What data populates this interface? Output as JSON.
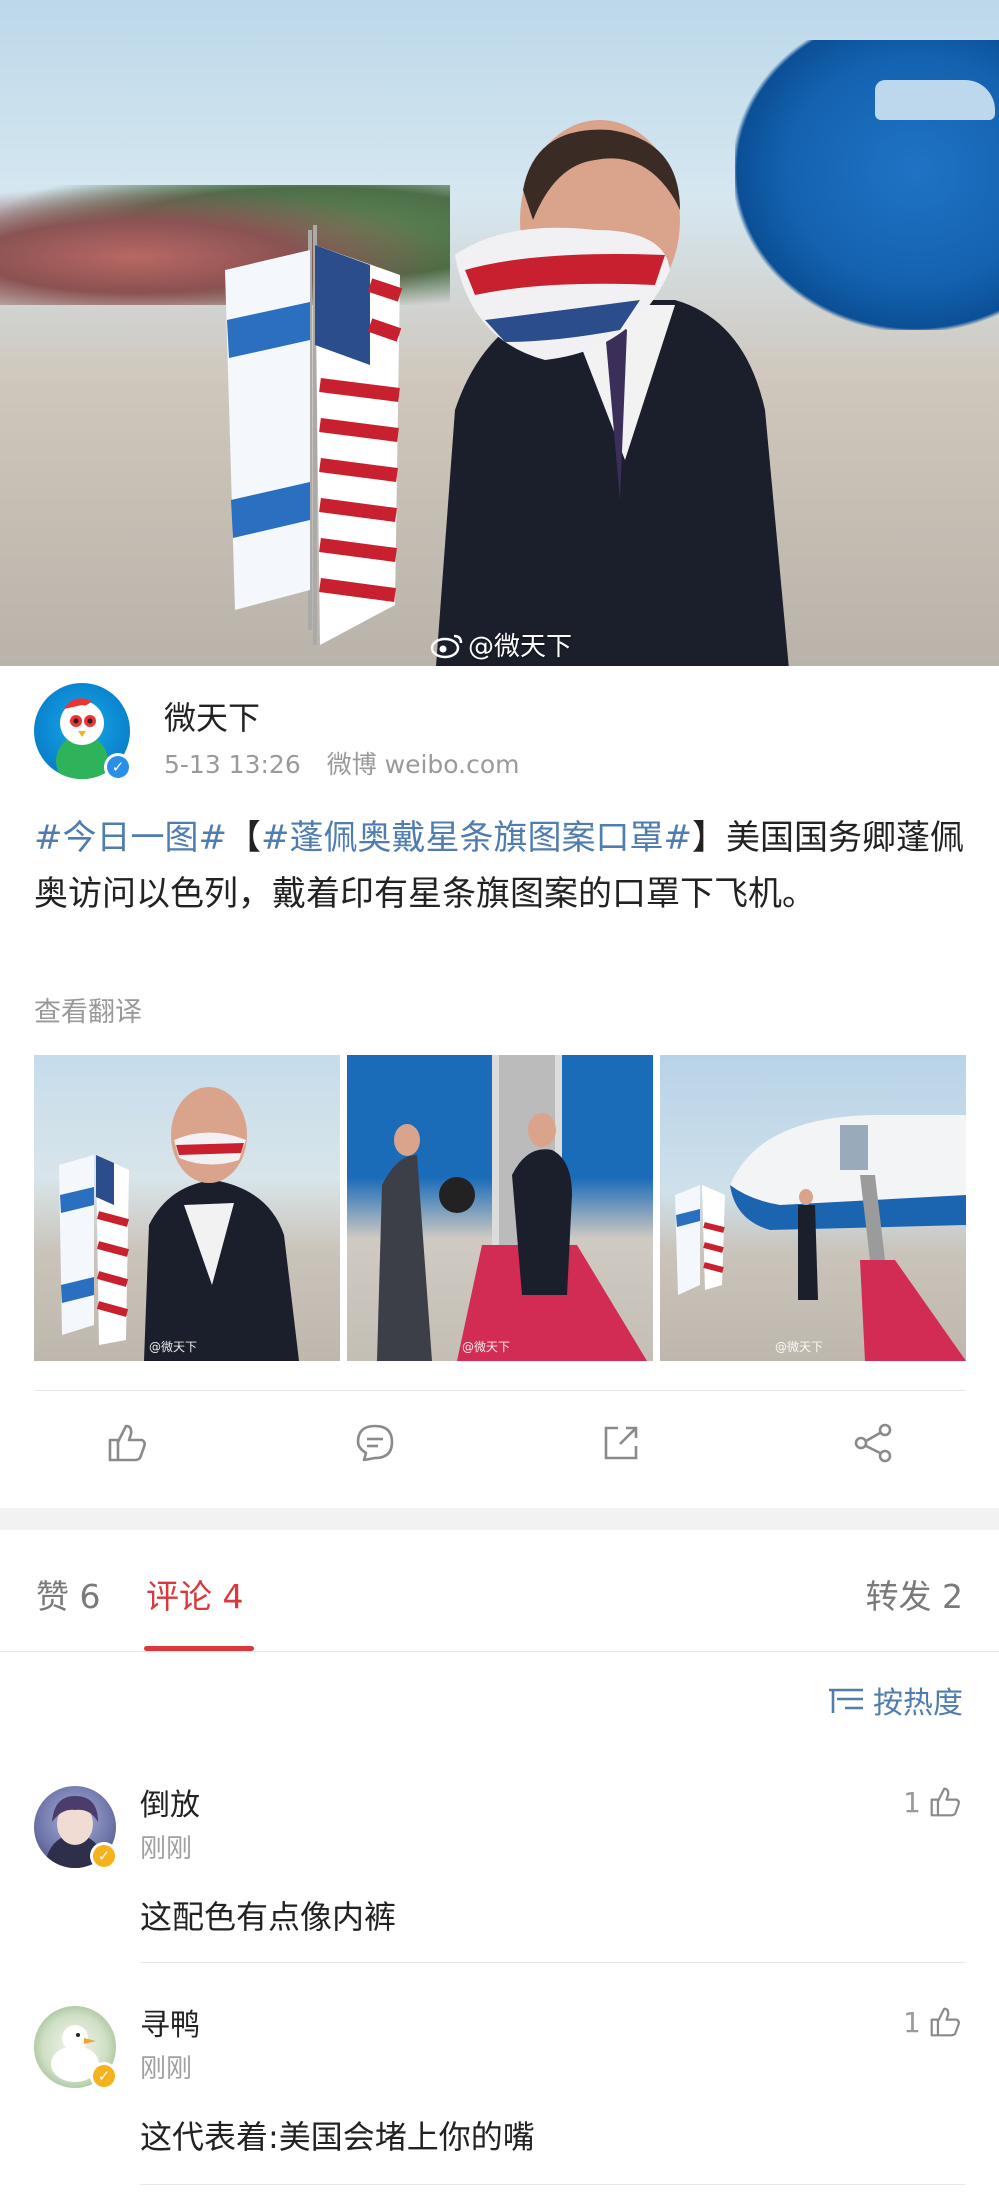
{
  "hero": {
    "watermark": "@微天下",
    "description_icon": "weibo-logo-icon"
  },
  "post": {
    "author": "微天下",
    "timestamp": "5-13 13:26",
    "source": "微博 weibo.com",
    "tag1": "#今日一图#",
    "bracket_open": "【",
    "tag2": "#蓬佩奥戴星条旗图案口罩#",
    "bracket_close": "】",
    "body": "美国国务卿蓬佩奥访问以色列，戴着印有星条旗图案的口罩下飞机。",
    "translate_link": "查看翻译",
    "thumb_watermark": "@微天下"
  },
  "actions": {
    "like_icon": "thumb-up-icon",
    "comment_icon": "comment-icon",
    "repost_icon": "repost-icon",
    "share_icon": "share-icon"
  },
  "tabs": {
    "likes": "赞 6",
    "comments": "评论 4",
    "reposts": "转发 2"
  },
  "sort": {
    "label": "按热度",
    "icon": "sort-icon"
  },
  "comments": [
    {
      "name": "倒放",
      "time": "刚刚",
      "text": "这配色有点像内裤",
      "likes": "1"
    },
    {
      "name": "寻鸭",
      "time": "刚刚",
      "text": "这代表着:美国会堵上你的嘴",
      "likes": "1"
    }
  ],
  "colors": {
    "accent_red": "#d9393d",
    "link_blue": "#507daf",
    "verify_blue": "#2a8fe8",
    "verify_gold": "#f5b21b"
  }
}
